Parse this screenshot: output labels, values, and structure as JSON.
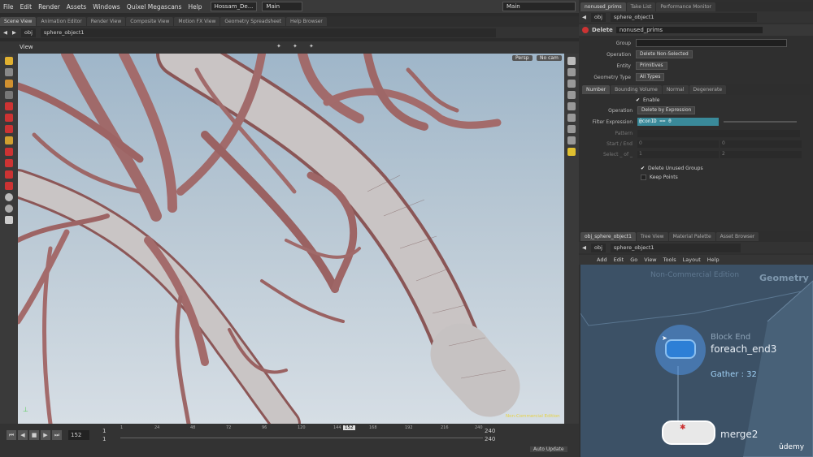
{
  "menubar": {
    "items": [
      "File",
      "Edit",
      "Render",
      "Assets",
      "Windows",
      "Quixel Megascans",
      "Help"
    ],
    "project": "Hossam_De...",
    "desktop1": "Main",
    "desktop2": "Main"
  },
  "top_tabs": [
    "Scene View",
    "Animation Editor",
    "Render View",
    "Composite View",
    "Motion FX View",
    "Geometry Spreadsheet",
    "Help Browser"
  ],
  "path": {
    "root": "obj",
    "node": "sphere_object1"
  },
  "viewport": {
    "label": "View",
    "persp": "Persp",
    "cam": "No cam",
    "watermark": "Non-Commercial Edition"
  },
  "timeline": {
    "current_frame": "152",
    "start": "1",
    "start2": "1",
    "end": "240",
    "end2": "240",
    "ticks": [
      "1",
      "24",
      "48",
      "72",
      "96",
      "120",
      "144",
      "152",
      "168",
      "192",
      "216",
      "240"
    ],
    "update_mode": "Auto Update"
  },
  "right_top": {
    "tabs": [
      "nonused_prims",
      "Take List",
      "Performance Monitor"
    ],
    "path_root": "obj",
    "path_node": "sphere_object1",
    "node_type": "Delete",
    "node_name": "nonused_prims",
    "params": {
      "group_label": "Group",
      "operation_label": "Operation",
      "operation_value": "Delete Non-Selected",
      "entity_label": "Entity",
      "entity_value": "Primitives",
      "geotype_label": "Geometry Type",
      "geotype_value": "All Types"
    },
    "subtabs": [
      "Number",
      "Bounding Volume",
      "Normal",
      "Degenerate"
    ],
    "enable_label": "Enable",
    "op2_label": "Operation",
    "op2_value": "Delete by Expression",
    "filter_label": "Filter Expression",
    "filter_value": "@conID == 0",
    "pattern_label": "Pattern",
    "startend_label": "Start / End",
    "startend_a": "0",
    "startend_b": "0",
    "select_label": "Select _ of _",
    "select_a": "1",
    "select_b": "2",
    "delete_unused": "Delete Unused Groups",
    "keep_points": "Keep Points"
  },
  "right_bottom": {
    "tabs": [
      "obj_sphere_object1",
      "Tree View",
      "Material Palette",
      "Asset Browser"
    ],
    "path_root": "obj",
    "path_node": "sphere_object1",
    "menu": [
      "Add",
      "Edit",
      "Go",
      "View",
      "Tools",
      "Layout",
      "Help"
    ],
    "watermark": "Non-Commercial Edition",
    "context": "Geometry",
    "block_label": "Block End",
    "block_name": "foreach_end3",
    "gather": "Gather : 32",
    "merge_name": "merge2",
    "brand": "ûdemy"
  }
}
